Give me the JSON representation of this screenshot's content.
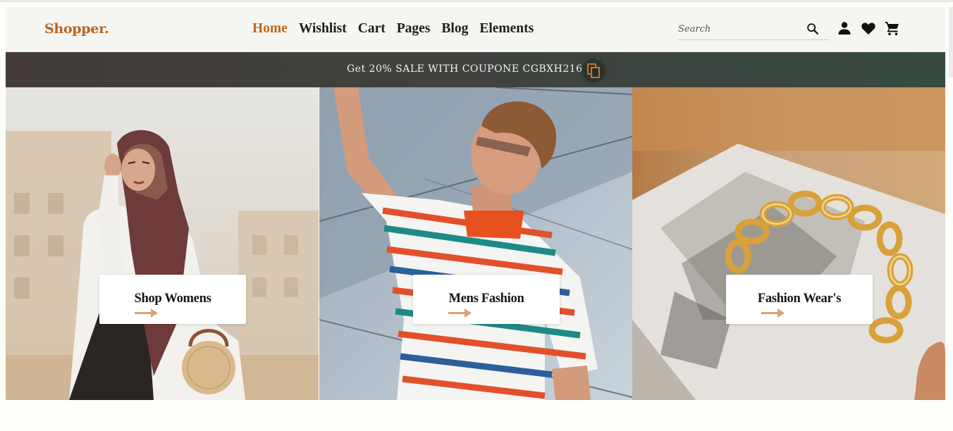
{
  "header": {
    "logo": "Shopper.",
    "nav": [
      {
        "label": "Home",
        "active": true
      },
      {
        "label": "Wishlist",
        "active": false
      },
      {
        "label": "Cart",
        "active": false
      },
      {
        "label": "Pages",
        "active": false
      },
      {
        "label": "Blog",
        "active": false
      },
      {
        "label": "Elements",
        "active": false
      }
    ],
    "search": {
      "placeholder": "Search",
      "value": ""
    },
    "icons": [
      "search-icon",
      "user-icon",
      "heart-icon",
      "cart-icon"
    ]
  },
  "banner": {
    "text": "Get 20% SALE WITH COUPONE CGBXH216",
    "copy_icon": "copy-icon"
  },
  "tiles": [
    {
      "label": "Shop Womens",
      "icon": "arrow-right-icon"
    },
    {
      "label": "Mens Fashion",
      "icon": "arrow-right-icon"
    },
    {
      "label": "Fashion Wear's",
      "icon": "arrow-right-icon"
    }
  ],
  "colors": {
    "accent": "#c0641d",
    "arrow": "#dba274",
    "banner_left": "#423b37",
    "banner_right": "#364a3f",
    "header_bg": "#f5f5f1"
  }
}
